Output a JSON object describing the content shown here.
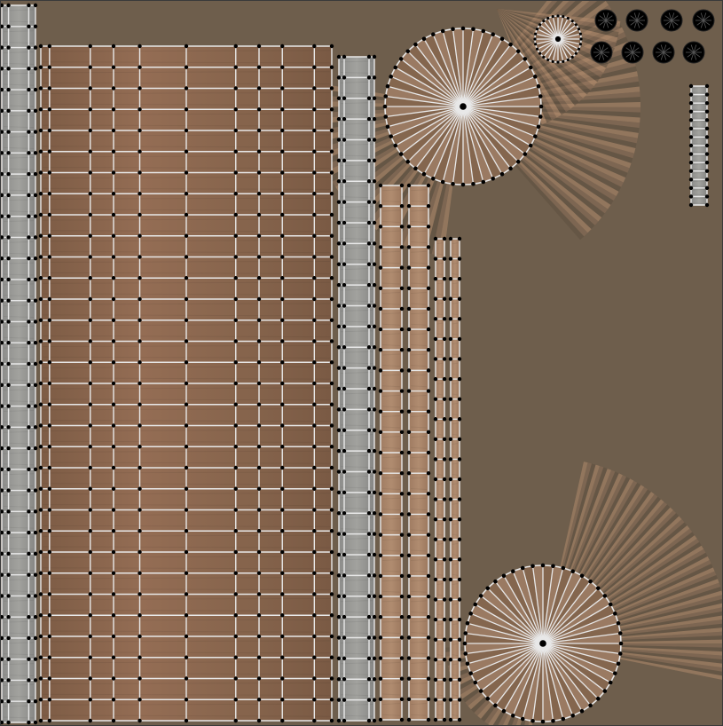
{
  "texture_atlas": {
    "colors": {
      "background": "#6e5e4c",
      "wood": "#8e6850",
      "wood_dark": "#7a5a44",
      "wood_light": "#a8856a",
      "stone": "#8a8a88",
      "stone_light": "#b4b4b0",
      "wireframe_edge": "#e8e8e8",
      "wireframe_vertex": "#000000",
      "ray_light": "#b08a6c",
      "ray_dark": "#5e5040",
      "border": "#3a3a3a"
    },
    "islands": [
      {
        "name": "stone-strip-left",
        "kind": "grid",
        "material": "stone"
      },
      {
        "name": "wood-panel-large",
        "kind": "grid",
        "material": "wood"
      },
      {
        "name": "stone-strip-center",
        "kind": "grid",
        "material": "stone"
      },
      {
        "name": "wood-strip-a",
        "kind": "grid",
        "material": "wood_light"
      },
      {
        "name": "wood-strip-b",
        "kind": "grid",
        "material": "wood_light"
      },
      {
        "name": "wood-strip-c",
        "kind": "grid",
        "material": "wood_light"
      },
      {
        "name": "wood-strip-d",
        "kind": "grid",
        "material": "wood_light"
      },
      {
        "name": "stone-strip-small-right",
        "kind": "grid",
        "material": "stone"
      },
      {
        "name": "wheel-top",
        "kind": "radial",
        "material": "wood"
      },
      {
        "name": "wheel-bottom",
        "kind": "radial",
        "material": "wood"
      },
      {
        "name": "hub-small",
        "kind": "radial",
        "material": "wood"
      },
      {
        "name": "bolt-cap",
        "kind": "dot",
        "material": "wireframe_vertex"
      }
    ]
  }
}
